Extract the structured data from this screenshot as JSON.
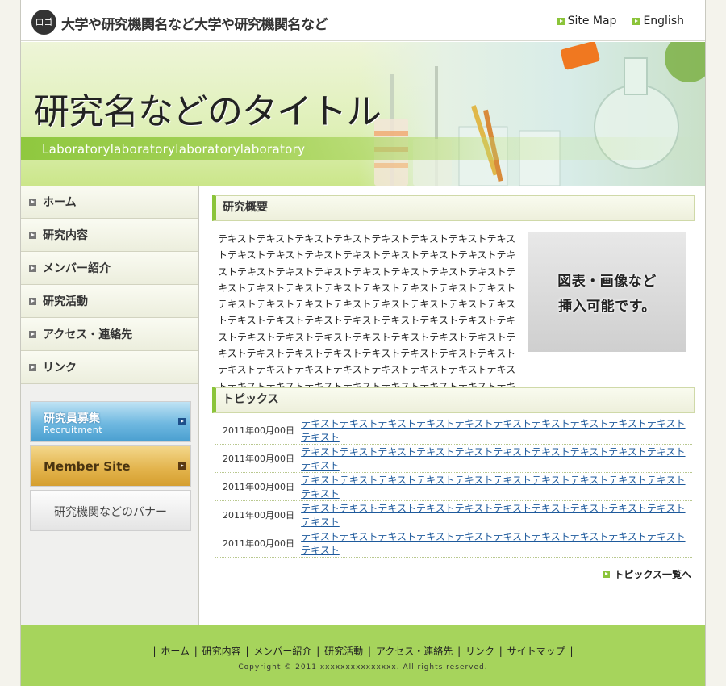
{
  "header": {
    "logo": "ロゴ",
    "site_name": "大学や研究機関名など大学や研究機関名など",
    "links": [
      {
        "label": "Site Map"
      },
      {
        "label": "English"
      }
    ]
  },
  "hero": {
    "title": "研究名などのタイトル",
    "subtitle": "Laboratorylaboratorylaboratorylaboratory"
  },
  "sidebar": {
    "items": [
      {
        "label": "ホーム"
      },
      {
        "label": "研究内容"
      },
      {
        "label": "メンバー紹介"
      },
      {
        "label": "研究活動"
      },
      {
        "label": "アクセス・連絡先"
      },
      {
        "label": "リンク"
      }
    ],
    "banners": {
      "recruit_title": "研究員募集",
      "recruit_sub": "Recruitment",
      "member": "Member Site",
      "institution": "研究機関などのバナー"
    }
  },
  "overview": {
    "heading": "研究概要",
    "text": "テキストテキストテキストテキストテキストテキストテキストテキストテキストテキストテキストテキストテキストテキストテキストテキストテキストテキストテキストテキストテキストテキストテキストテキストテキストテキストテキストテキストテキストテキストテキストテキストテキストテキストテキストテキストテキストテキストテキストテキストテキストテキストテキストテキストテキストテキストテキストテキストテキストテキストテキストテキストテキストテキストテキストテキストテキストテキストテキストテキストテキストテキストテキストテキストテキストテキストテキストテキストテキストテキストテキストテキストテキストテキストテキストテキストテキストテキストテキストテキスト",
    "figure_line1": "図表・画像など",
    "figure_line2": "挿入可能です。"
  },
  "topics": {
    "heading": "トピックス",
    "items": [
      {
        "date": "2011年00月00日",
        "text": "テキストテキストテキストテキストテキストテキストテキストテキストテキストテキストテキスト"
      },
      {
        "date": "2011年00月00日",
        "text": "テキストテキストテキストテキストテキストテキストテキストテキストテキストテキストテキスト"
      },
      {
        "date": "2011年00月00日",
        "text": "テキストテキストテキストテキストテキストテキストテキストテキストテキストテキストテキスト"
      },
      {
        "date": "2011年00月00日",
        "text": "テキストテキストテキストテキストテキストテキストテキストテキストテキストテキストテキスト"
      },
      {
        "date": "2011年00月00日",
        "text": "テキストテキストテキストテキストテキストテキストテキストテキストテキストテキストテキスト"
      }
    ],
    "more": "トピックス一覧へ"
  },
  "footer": {
    "links": [
      {
        "label": "ホーム"
      },
      {
        "label": "研究内容"
      },
      {
        "label": "メンバー紹介"
      },
      {
        "label": "研究活動"
      },
      {
        "label": "アクセス・連絡先"
      },
      {
        "label": "リンク"
      },
      {
        "label": "サイトマップ"
      }
    ],
    "copyright": "Copyright © 2011 xxxxxxxxxxxxxxx. All rights reserved."
  },
  "colors": {
    "accent_green": "#8bc43a",
    "footer_green": "#a6d45c",
    "link_blue": "#1e5a9c"
  }
}
